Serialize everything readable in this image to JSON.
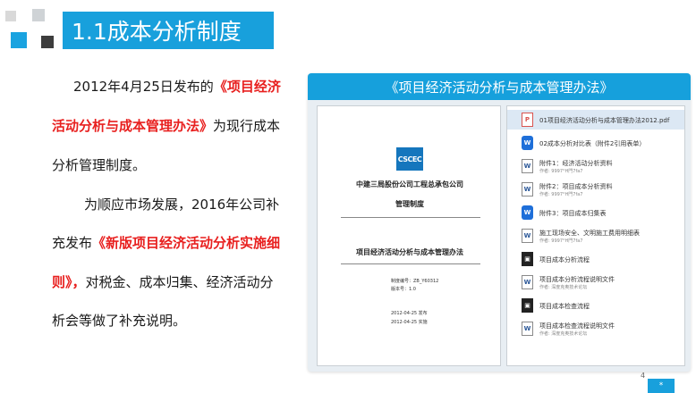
{
  "slide": {
    "title": "1.1成本分析制度",
    "page_number": "4",
    "corner_mark": "*"
  },
  "paragraph1": {
    "line1_prefix": "2012年4月25日发布的",
    "line1_red": "《项目经济",
    "line2_red": "活动分析与成本管理办法》",
    "line2_suffix": "为现行成本",
    "line3": "分析管理制度。"
  },
  "paragraph2": {
    "line1": "为顺应市场发展，2016年公司补",
    "line2_prefix": "充发布",
    "line2_red": "《新版项目经济活动分析实施细",
    "line3_red": "则》，",
    "line3_suffix": "对税金、成本归集、经济活动分",
    "line4": "析会等做了补充说明。"
  },
  "panel": {
    "header": "《项目经济活动分析与成本管理办法》"
  },
  "document": {
    "logo_text": "CSCEC",
    "company": "中建三局股份公司工程总承包公司",
    "doc_type": "管理制度",
    "doc_title": "项目经济活动分析与成本管理办法",
    "meta_code": "制度编号：ZB_Y60312",
    "meta_version": "版本号：1.0",
    "date_publish": "2012-04-25  发布",
    "date_effective": "2012-04-25  实施"
  },
  "files": [
    {
      "icon": "pdf",
      "name": "01项目经济活动分析与成本管理办法2012.pdf",
      "sub": ""
    },
    {
      "icon": "wps",
      "name": "02成本分析对比表（附件2引用表单）",
      "sub": ""
    },
    {
      "icon": "doc",
      "name": "附件1：经济活动分析资料",
      "sub": "作者: 9997°H門7fa7"
    },
    {
      "icon": "doc",
      "name": "附件2：项目成本分析资料",
      "sub": "作者: 9997°H門7fa7"
    },
    {
      "icon": "wps",
      "name": "附件3：项目成本归集表",
      "sub": ""
    },
    {
      "icon": "doc",
      "name": "施工现场安全、文明施工费用明细表",
      "sub": "作者: 9997°H門7fa7"
    },
    {
      "icon": "app",
      "name": "项目成本分析流程",
      "sub": ""
    },
    {
      "icon": "doc",
      "name": "项目成本分析流程说明文件",
      "sub": "作者: 深度克奥技术论坛"
    },
    {
      "icon": "app",
      "name": "项目成本检查流程",
      "sub": ""
    },
    {
      "icon": "doc",
      "name": "项目成本检查流程说明文件",
      "sub": "作者: 深度克奥技术论坛"
    }
  ]
}
